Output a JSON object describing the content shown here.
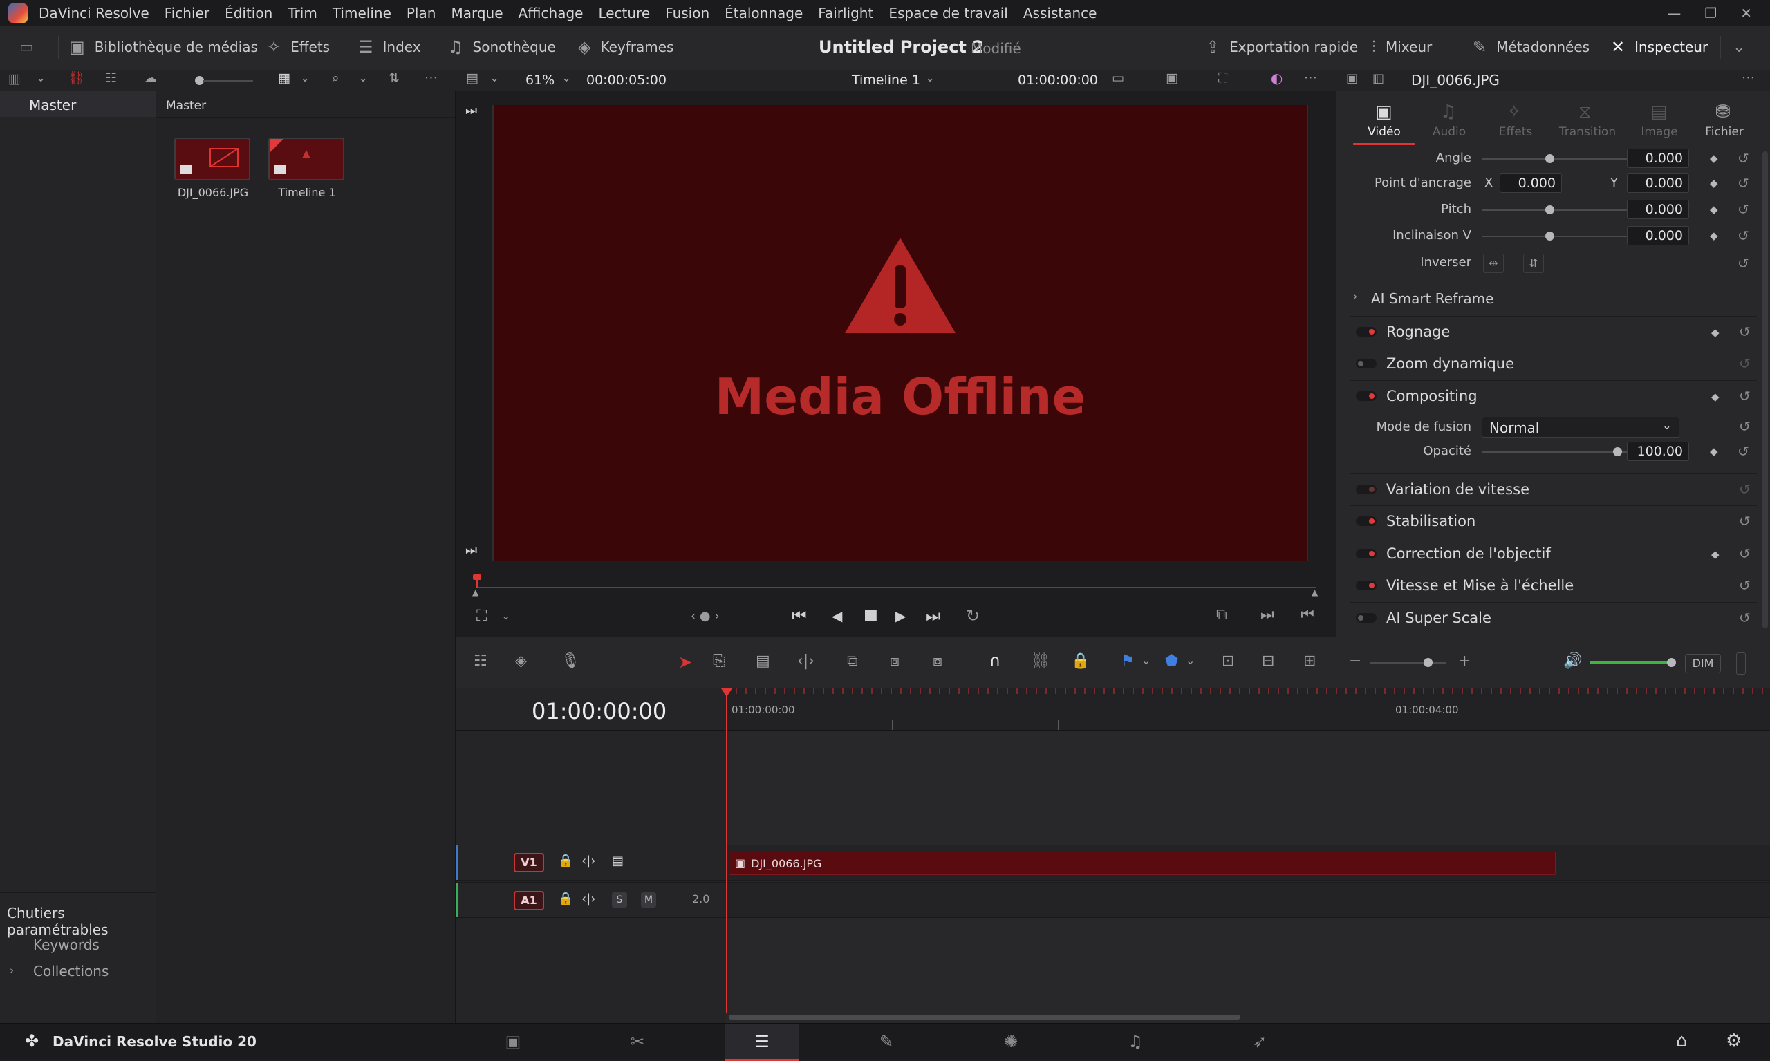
{
  "menu": {
    "items": [
      "DaVinci Resolve",
      "Fichier",
      "Édition",
      "Trim",
      "Timeline",
      "Plan",
      "Marque",
      "Affichage",
      "Lecture",
      "Fusion",
      "Étalonnage",
      "Fairlight",
      "Espace de travail",
      "Assistance"
    ]
  },
  "toolbar": {
    "media_library": "Bibliothèque de médias",
    "effects": "Effets",
    "index": "Index",
    "sound_library": "Sonothèque",
    "keyframes": "Keyframes",
    "project_title": "Untitled Project 2",
    "project_state": "Modifié",
    "quick_export": "Exportation rapide",
    "mixer": "Mixeur",
    "metadata": "Métadonnées",
    "inspector": "Inspecteur"
  },
  "viewer_bar": {
    "zoom": "61%",
    "duration": "00:00:05:00",
    "timeline_name": "Timeline 1",
    "timecode": "01:00:00:00"
  },
  "bins": {
    "master": "Master",
    "smart_bins_title": "Chutiers paramétrables",
    "keywords": "Keywords",
    "collections": "Collections"
  },
  "media_pool": {
    "header": "Master",
    "clips": [
      {
        "name": "DJI_0066.JPG"
      },
      {
        "name": "Timeline 1"
      }
    ]
  },
  "viewer": {
    "offline_text": "Media Offline"
  },
  "inspector": {
    "clip_name": "DJI_0066.JPG",
    "tabs": [
      "Vidéo",
      "Audio",
      "Effets",
      "Transition",
      "Image",
      "Fichier"
    ],
    "active_tab": "Vidéo",
    "rows": {
      "angle": {
        "label": "Angle",
        "value": "0.000"
      },
      "anchor": {
        "label": "Point d'ancrage",
        "x_label": "X",
        "x": "0.000",
        "y_label": "Y",
        "y": "0.000"
      },
      "pitch": {
        "label": "Pitch",
        "value": "0.000"
      },
      "tilt": {
        "label": "Inclinaison V",
        "value": "0.000"
      },
      "flip": {
        "label": "Inverser"
      }
    },
    "smart_reframe": "AI Smart Reframe",
    "sections": {
      "crop": "Rognage",
      "dynamic_zoom": "Zoom dynamique",
      "compositing": "Compositing",
      "speed_change": "Variation de vitesse",
      "stabilization": "Stabilisation",
      "lens_correction": "Correction de l'objectif",
      "retime_scaling": "Vitesse et Mise à l'échelle",
      "super_scale": "AI Super Scale"
    },
    "blend_mode_label": "Mode de fusion",
    "blend_mode_value": "Normal",
    "opacity_label": "Opacité",
    "opacity_value": "100.00"
  },
  "timeline": {
    "timecode": "01:00:00:00",
    "ruler_start": "01:00:00:00",
    "ruler_mark": "01:00:04:00",
    "tracks": {
      "v1": "V1",
      "a1": "A1",
      "a1_solo": "S",
      "a1_mute": "M",
      "a1_channels": "2.0"
    },
    "clip_name": "DJI_0066.JPG",
    "dim_label": "DIM"
  },
  "bottom": {
    "app_name": "DaVinci Resolve Studio 20"
  }
}
